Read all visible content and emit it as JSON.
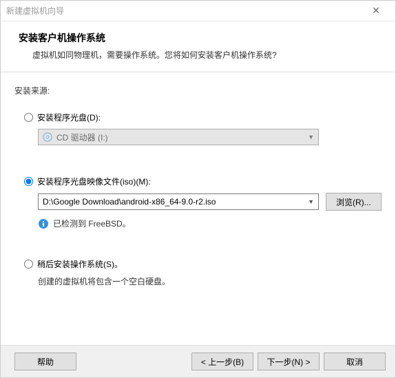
{
  "titlebar": {
    "title": "新建虚拟机向导",
    "close": "✕"
  },
  "header": {
    "title": "安装客户机操作系统",
    "subtitle": "虚拟机如同物理机，需要操作系统。您将如何安装客户机操作系统?"
  },
  "source_label": "安装来源:",
  "options": {
    "disc": {
      "label": "安装程序光盘(D):",
      "drive": "CD 驱动器 (I:)"
    },
    "iso": {
      "label": "安装程序光盘映像文件(iso)(M):",
      "path": "D:\\Google Download\\android-x86_64-9.0-r2.iso",
      "browse": "浏览(R)...",
      "detected": "已检测到 FreeBSD。"
    },
    "later": {
      "label": "稍后安装操作系统(S)。",
      "desc": "创建的虚拟机将包含一个空白硬盘。"
    }
  },
  "footer": {
    "help": "帮助",
    "back": "< 上一步(B)",
    "next": "下一步(N) >",
    "cancel": "取消"
  }
}
